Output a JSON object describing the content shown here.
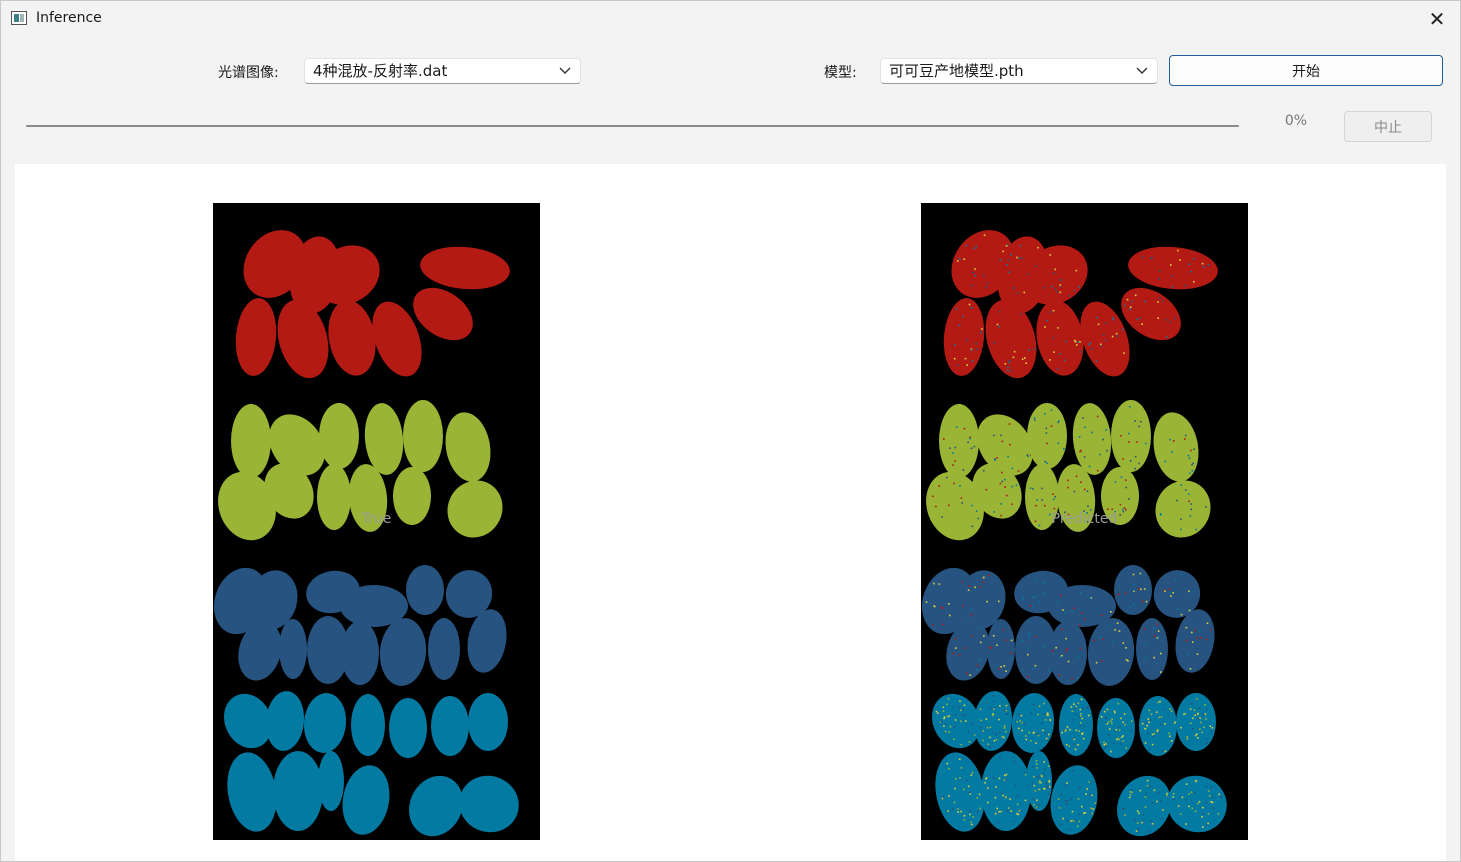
{
  "window": {
    "title": "Inference",
    "close_label": "✕"
  },
  "spectral": {
    "label": "光谱图像:",
    "value": "4种混放-反射率.dat"
  },
  "model": {
    "label": "模型:",
    "value": "可可豆产地模型.pth"
  },
  "start_label": "开始",
  "progress": {
    "value": 0,
    "text": "0%"
  },
  "stop_label": "中止",
  "panels": {
    "true_caption": "True",
    "predicted_caption": "Predicted"
  },
  "colors": {
    "red": "#b41a14",
    "green": "#9ab535",
    "navy": "#26537f",
    "teal": "#037aa2",
    "speckle_yellow": "#d9d23a",
    "accent": "#005fb8"
  }
}
